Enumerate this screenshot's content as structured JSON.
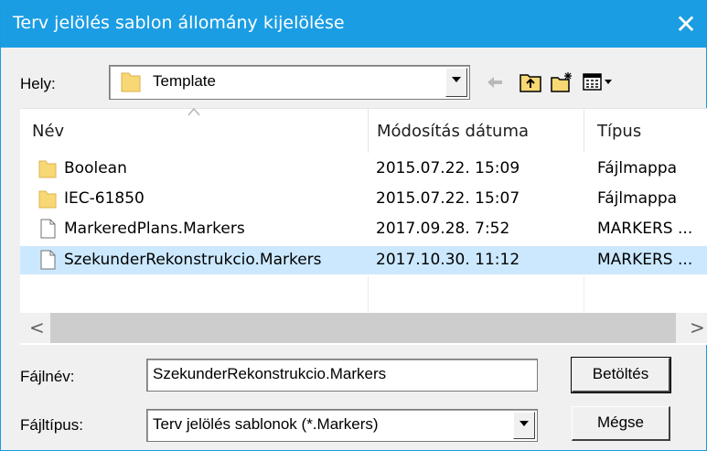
{
  "window": {
    "title": "Terv jelölés sablon állomány kijelölése"
  },
  "location": {
    "label": "Hely:",
    "value": "Template"
  },
  "toolbar": {
    "icons": [
      "back-arrow-icon",
      "up-folder-icon",
      "new-folder-icon",
      "view-menu-icon"
    ]
  },
  "list": {
    "columns": [
      "Név",
      "Módosítás dátuma",
      "Típus"
    ],
    "rows": [
      {
        "name": "Boolean",
        "date": "2015.07.22. 15:09",
        "type": "Fájlmappa",
        "icon": "folder-icon"
      },
      {
        "name": "IEC-61850",
        "date": "2015.07.22. 15:07",
        "type": "Fájlmappa",
        "icon": "folder-icon"
      },
      {
        "name": "MarkeredPlans.Markers",
        "date": "2017.09.28. 7:52",
        "type": "MARKERS ...",
        "icon": "file-icon"
      },
      {
        "name": "SzekunderRekonstrukcio.Markers",
        "date": "2017.10.30. 11:12",
        "type": "MARKERS ...",
        "icon": "file-icon"
      }
    ],
    "selected_index": 3
  },
  "scrollbar": {
    "left": "<",
    "right": ">"
  },
  "filename": {
    "label": "Fájlnév:",
    "value": "SzekunderRekonstrukcio.Markers"
  },
  "filetype": {
    "label": "Fájltípus:",
    "value": "Terv jelölés sablonok (*.Markers)"
  },
  "buttons": {
    "load": "Betöltés",
    "cancel": "Mégse"
  },
  "colors": {
    "titlebar": "#1b9de3",
    "selection": "#cce8ff",
    "folder": "#f8d775"
  }
}
